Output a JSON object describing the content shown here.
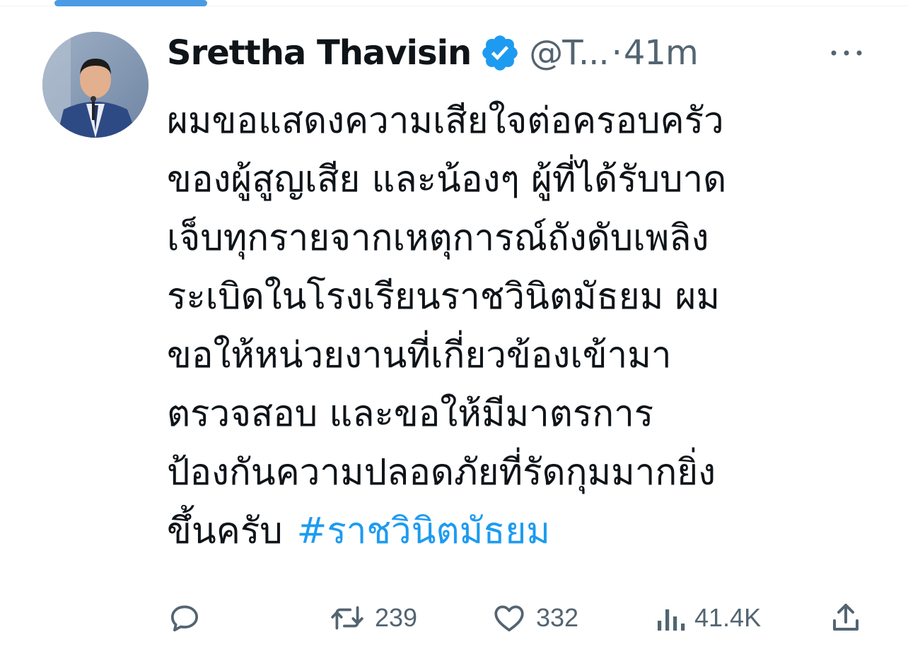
{
  "tweet": {
    "author": {
      "display_name": "Srettha Thavisin",
      "handle": "@T...",
      "verified": true
    },
    "separator": "·",
    "time": "41m",
    "text_lines": [
      "ผมขอแสดงความเสียใจต่อครอบครัว",
      "ของผู้สูญเสีย และน้องๆ ผู้ที่ได้รับบาด",
      "เจ็บทุกรายจากเหตุการณ์ถังดับเพลิง",
      "ระเบิดในโรงเรียนราชวินิตมัธยม ผม",
      "ขอให้หน่วยงานที่เกี่ยวข้องเข้ามา",
      "ตรวจสอบ และขอให้มีมาตรการ",
      "ป้องกันความปลอดภัยที่รัดกุมมากยิ่ง",
      "ขึ้นครับ"
    ],
    "hashtag": "#ราชวินิตมัธยม",
    "stats": {
      "replies": "",
      "retweets": "239",
      "likes": "332",
      "views": "41.4K"
    }
  },
  "icons": {
    "verified": "verified-badge-icon",
    "more": "more-options-icon",
    "reply": "reply-icon",
    "retweet": "retweet-icon",
    "like": "heart-icon",
    "views": "views-icon",
    "share": "share-icon"
  },
  "colors": {
    "accent": "#1d9bf0",
    "text_primary": "#0f1419",
    "text_secondary": "#536471",
    "tab_indicator": "#4a9ae4"
  }
}
